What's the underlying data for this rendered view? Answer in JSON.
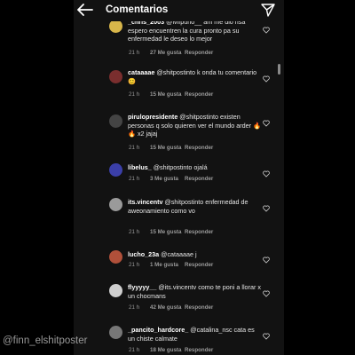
{
  "header": {
    "title": "Comentarios",
    "back_icon": "arrow-left-icon",
    "send_icon": "send-icon"
  },
  "comments": [
    {
      "user": "_chris_2003",
      "text": " @lvlfpuno__ am me dio risa espero encuentren la cura pronto pa su enfermedad le deseo lo mejor",
      "time": "21 h",
      "likes": "27 Me gusta",
      "reply": "Responder",
      "avatar_color": "#d8b64a"
    },
    {
      "user": "cataaaae",
      "text": " @shitpostinto k onda tu comentario 😊",
      "time": "21 h",
      "likes": "15 Me gusta",
      "reply": "Responder",
      "avatar_color": "#7a2e2e"
    },
    {
      "user": "pirulopresidente",
      "text": " @shitpostinto existen personas q solo quieren ver el mundo arder 🔥🔥 x2 jajaj",
      "time": "21 h",
      "likes": "15 Me gusta",
      "reply": "Responder",
      "avatar_color": "#444444"
    },
    {
      "user": "libelus_",
      "text": " @shitpostinto ojalá",
      "time": "21 h",
      "likes": "3 Me gusta",
      "reply": "Responder",
      "avatar_color": "#3b3fa8"
    },
    {
      "user": "its.vincentv",
      "text": " @shitpostinto enfermedad de aweonamiento como vo",
      "time": "21 h",
      "likes": "15 Me gusta",
      "reply": "Responder",
      "avatar_color": "#9a9a9a"
    },
    {
      "user": "lucho_23a",
      "text": " @cataaaae j",
      "time": "21 h",
      "likes": "1 Me gusta",
      "reply": "Responder",
      "avatar_color": "#b0503a"
    },
    {
      "user": "flyyyyy__",
      "text": " @its.vincentv como te poni a llorar x un chocmans",
      "time": "21 h",
      "likes": "42 Me gusta",
      "reply": "Responder",
      "avatar_color": "#cfcfcf"
    },
    {
      "user": "_pancito_hardcore_",
      "text": " @catalina_nsc cata es un chiste calmate",
      "time": "21 h",
      "likes": "18 Me gusta",
      "reply": "Responder",
      "avatar_color": "#777777"
    }
  ],
  "watermark": "@finn_elshitposter"
}
